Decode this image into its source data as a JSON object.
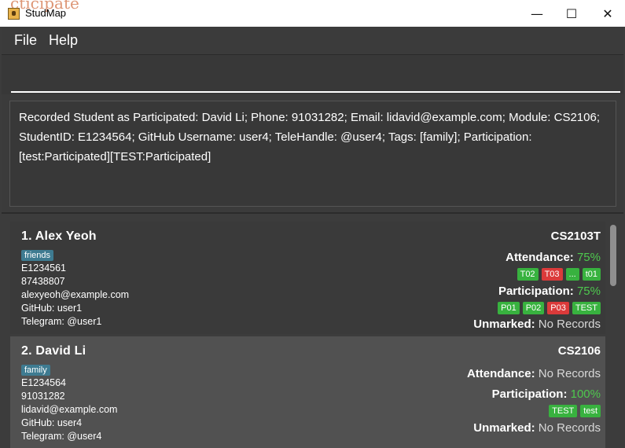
{
  "window": {
    "title": "StudMap",
    "minimize": "—",
    "maximize": "☐",
    "close": "✕",
    "ghost_text": "cticipate"
  },
  "menu": {
    "file": "File",
    "help": "Help"
  },
  "command": {
    "value": "",
    "placeholder": ""
  },
  "result": {
    "text": "Recorded Student as Participated: David Li; Phone: 91031282; Email: lidavid@example.com; Module: CS2106; StudentID: E1234564; GitHub Username: user4; TeleHandle: @user4; Tags: [family]; Participation: [test:Participated][TEST:Participated]"
  },
  "students": [
    {
      "index_name": "1.  Alex Yeoh",
      "tag": "friends",
      "student_id": "E1234561",
      "phone": "87438807",
      "email": "alexyeoh@example.com",
      "github": "GitHub: user1",
      "telegram": "Telegram: @user1",
      "module": "CS2103T",
      "attendance_label": "Attendance:",
      "attendance_value": "75%",
      "attendance_chips": [
        {
          "text": "T02",
          "status": "green"
        },
        {
          "text": "T03",
          "status": "red"
        },
        {
          "text": "...",
          "status": "green"
        },
        {
          "text": "t01",
          "status": "green"
        }
      ],
      "participation_label": "Participation:",
      "participation_value": "75%",
      "participation_chips": [
        {
          "text": "P01",
          "status": "green"
        },
        {
          "text": "P02",
          "status": "green"
        },
        {
          "text": "P03",
          "status": "red"
        },
        {
          "text": "TEST",
          "status": "green"
        }
      ],
      "unmarked_label": "Unmarked:",
      "unmarked_value": "No Records"
    },
    {
      "index_name": "2.  David Li",
      "tag": "family",
      "student_id": "E1234564",
      "phone": "91031282",
      "email": "lidavid@example.com",
      "github": "GitHub: user4",
      "telegram": "Telegram: @user4",
      "module": "CS2106",
      "attendance_label": "Attendance:",
      "attendance_value": "No Records",
      "participation_label": "Participation:",
      "participation_value": "100%",
      "participation_chips": [
        {
          "text": "TEST",
          "status": "green"
        },
        {
          "text": "test",
          "status": "green"
        }
      ],
      "unmarked_label": "Unmarked:",
      "unmarked_value": "No Records"
    }
  ],
  "colors": {
    "present": "#38b23f",
    "absent": "#db3a3a",
    "percent": "#4ec84e",
    "tag": "#3e7b91",
    "background": "#3c3c3c"
  }
}
